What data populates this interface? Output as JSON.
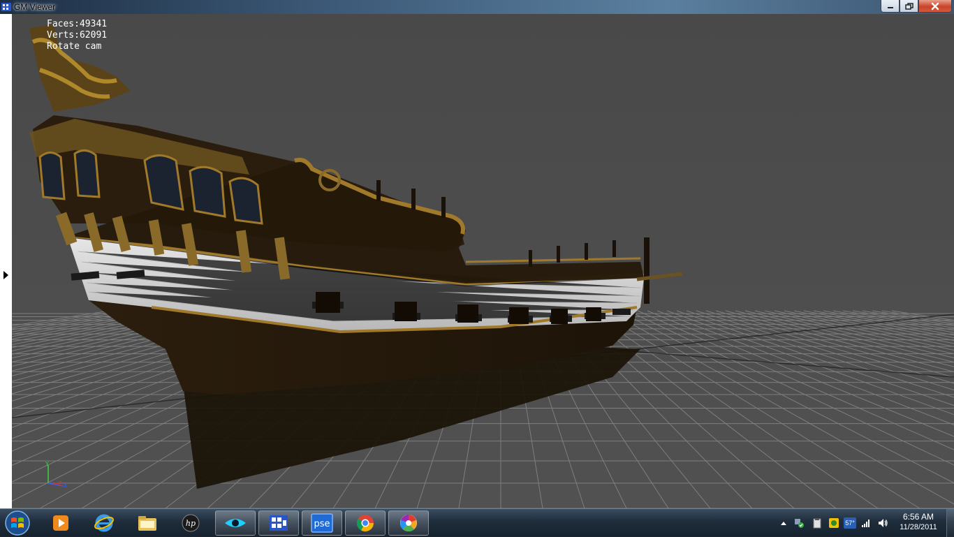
{
  "window": {
    "title": "GM Viewer"
  },
  "hud": {
    "faces": "Faces:49341",
    "verts": "Verts:62091",
    "mode": "Rotate cam"
  },
  "axis_gizmo": {
    "y_label": "Y",
    "z_label": "Z",
    "x_label": "X",
    "colors": {
      "y": "#3cd43c",
      "z": "#e03030",
      "x": "#3c5aff"
    }
  },
  "scene": {
    "background_color": "#4b4b4b",
    "grid_line_color": "#9a9a9a",
    "hull_color": "#2a1c0c",
    "planking_color": "#d8d8d8",
    "gold_trim_color": "#a07a2a",
    "shadow_color": "#1a1206"
  },
  "taskbar": {
    "apps": [
      {
        "name": "media-player-icon",
        "active": false
      },
      {
        "name": "internet-explorer-icon",
        "active": false
      },
      {
        "name": "file-explorer-icon",
        "active": false
      },
      {
        "name": "hp-icon",
        "active": false
      },
      {
        "name": "eye-app-icon",
        "active": true
      },
      {
        "name": "gm-viewer-icon",
        "active": true
      },
      {
        "name": "photoshop-elements-icon",
        "active": true
      },
      {
        "name": "chrome-icon",
        "active": true
      },
      {
        "name": "picasa-icon",
        "active": true
      }
    ],
    "pse_label": "pse",
    "hp_label": "hp",
    "weather_temp": "57°",
    "clock_time": "6:56 AM",
    "clock_date": "11/28/2011"
  }
}
